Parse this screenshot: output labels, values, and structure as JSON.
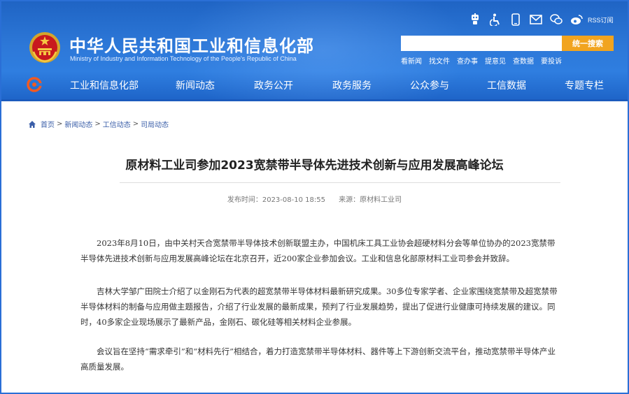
{
  "header": {
    "site_title": "中华人民共和国工业和信息化部",
    "site_subtitle": "Ministry of Industry and Information Technology of the People's Republic of China",
    "rss_label": "RSS订阅",
    "search": {
      "value": "",
      "placeholder": "",
      "button_label": "统一搜索"
    },
    "quick_links": [
      "看新闻",
      "找文件",
      "查办事",
      "提意见",
      "查数据",
      "要投诉"
    ],
    "top_icons": [
      "robot-icon",
      "accessibility-icon",
      "mobile-icon",
      "mail-icon",
      "wechat-icon",
      "weibo-icon",
      "rss-icon"
    ]
  },
  "nav": {
    "items": [
      "工业和信息化部",
      "新闻动态",
      "政务公开",
      "政务服务",
      "公众参与",
      "工信数据",
      "专题专栏"
    ]
  },
  "breadcrumb": {
    "items": [
      "首页",
      "新闻动态",
      "工信动态",
      "司局动态"
    ],
    "separator": ">"
  },
  "article": {
    "title": "原材料工业司参加2023宽禁带半导体先进技术创新与应用发展高峰论坛",
    "publish_time": "发布时间：2023-08-10 18:55",
    "source": "来源：原材料工业司",
    "paragraphs": [
      "2023年8月10日，由中关村天合宽禁带半导体技术创新联盟主办，中国机床工具工业协会超硬材料分会等单位协办的2023宽禁带半导体先进技术创新与应用发展高峰论坛在北京召开，近200家企业参加会议。工业和信息化部原材料工业司参会并致辞。",
      "吉林大学邹广田院士介绍了以金刚石为代表的超宽禁带半导体材料最新研究成果。30多位专家学者、企业家围绕宽禁带及超宽禁带半导体材料的制备与应用做主题报告，介绍了行业发展的最新成果，预判了行业发展趋势，提出了促进行业健康可持续发展的建议。同时，40多家企业现场展示了最新产品，金刚石、碳化硅等相关材料企业参展。",
      "会议旨在坚持“需求牵引”和“材料先行”相结合，着力打造宽禁带半导体材料、器件等上下游创新交流平台，推动宽禁带半导体产业高质量发展。"
    ]
  },
  "colors": {
    "header_blue": "#2d78d8",
    "search_button": "#f1a41f",
    "breadcrumb_link": "#3a5ea8",
    "frame_border": "#2a6fd6"
  }
}
